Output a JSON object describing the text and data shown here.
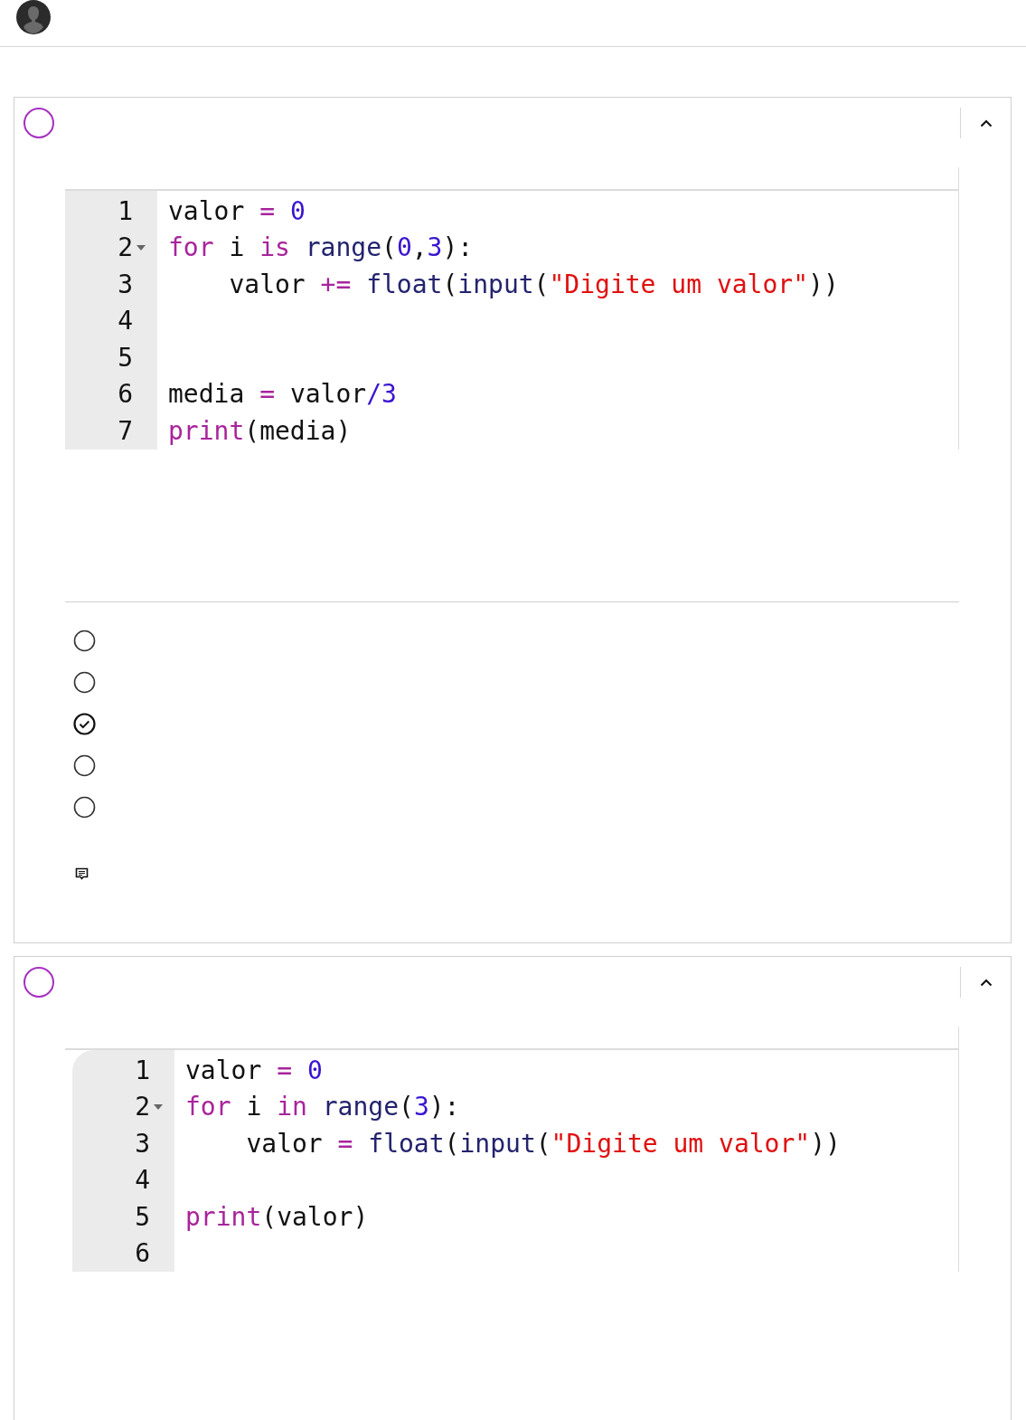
{
  "questions": [
    {
      "answered": false,
      "expanded": true,
      "code": {
        "rounded": false,
        "lines": [
          {
            "number": "1",
            "fold": false,
            "tokens": [
              {
                "text": "valor ",
                "kind": "plain"
              },
              {
                "text": "= ",
                "kind": "keyword"
              },
              {
                "text": "0",
                "kind": "number"
              }
            ]
          },
          {
            "number": "2",
            "fold": true,
            "tokens": [
              {
                "text": "for ",
                "kind": "keyword"
              },
              {
                "text": "i ",
                "kind": "plain"
              },
              {
                "text": "is ",
                "kind": "keyword"
              },
              {
                "text": "range",
                "kind": "builtin"
              },
              {
                "text": "(",
                "kind": "plain"
              },
              {
                "text": "0",
                "kind": "number"
              },
              {
                "text": ",",
                "kind": "plain"
              },
              {
                "text": "3",
                "kind": "number"
              },
              {
                "text": "):",
                "kind": "plain"
              }
            ]
          },
          {
            "number": "3",
            "fold": false,
            "tokens": [
              {
                "text": "    valor ",
                "kind": "plain"
              },
              {
                "text": "+= ",
                "kind": "keyword"
              },
              {
                "text": "float",
                "kind": "builtin"
              },
              {
                "text": "(",
                "kind": "plain"
              },
              {
                "text": "input",
                "kind": "builtin"
              },
              {
                "text": "(",
                "kind": "plain"
              },
              {
                "text": "\"Digite um valor\"",
                "kind": "string"
              },
              {
                "text": "))",
                "kind": "plain"
              }
            ]
          },
          {
            "number": "4",
            "fold": false
          },
          {
            "number": "5",
            "fold": false
          },
          {
            "number": "6",
            "fold": false,
            "tokens": [
              {
                "text": "media ",
                "kind": "plain"
              },
              {
                "text": "= ",
                "kind": "keyword"
              },
              {
                "text": "valor",
                "kind": "plain"
              },
              {
                "text": "/3",
                "kind": "number"
              }
            ]
          },
          {
            "number": "7",
            "fold": false,
            "tokens": [
              {
                "text": "print",
                "kind": "keyword"
              },
              {
                "text": "(media)",
                "kind": "plain"
              }
            ]
          }
        ]
      },
      "options": [
        {
          "selected": false
        },
        {
          "selected": false
        },
        {
          "selected": true
        },
        {
          "selected": false
        },
        {
          "selected": false
        }
      ]
    },
    {
      "answered": false,
      "expanded": true,
      "code": {
        "rounded": true,
        "lines": [
          {
            "number": "1",
            "fold": false,
            "tokens": [
              {
                "text": "valor ",
                "kind": "plain"
              },
              {
                "text": "= ",
                "kind": "keyword"
              },
              {
                "text": "0",
                "kind": "number"
              }
            ]
          },
          {
            "number": "2",
            "fold": true,
            "tokens": [
              {
                "text": "for ",
                "kind": "keyword"
              },
              {
                "text": "i ",
                "kind": "plain"
              },
              {
                "text": "in ",
                "kind": "keyword"
              },
              {
                "text": "range",
                "kind": "builtin"
              },
              {
                "text": "(",
                "kind": "plain"
              },
              {
                "text": "3",
                "kind": "number"
              },
              {
                "text": "):",
                "kind": "plain"
              }
            ]
          },
          {
            "number": "3",
            "fold": false,
            "tokens": [
              {
                "text": "    valor ",
                "kind": "plain"
              },
              {
                "text": "= ",
                "kind": "keyword"
              },
              {
                "text": "float",
                "kind": "builtin"
              },
              {
                "text": "(",
                "kind": "plain"
              },
              {
                "text": "input",
                "kind": "builtin"
              },
              {
                "text": "(",
                "kind": "plain"
              },
              {
                "text": "\"Digite um valor\"",
                "kind": "string"
              },
              {
                "text": "))",
                "kind": "plain"
              }
            ]
          },
          {
            "number": "4",
            "fold": false
          },
          {
            "number": "5",
            "fold": false,
            "tokens": [
              {
                "text": "print",
                "kind": "keyword"
              },
              {
                "text": "(valor)",
                "kind": "plain"
              }
            ]
          },
          {
            "number": "6",
            "fold": false
          }
        ]
      }
    }
  ]
}
